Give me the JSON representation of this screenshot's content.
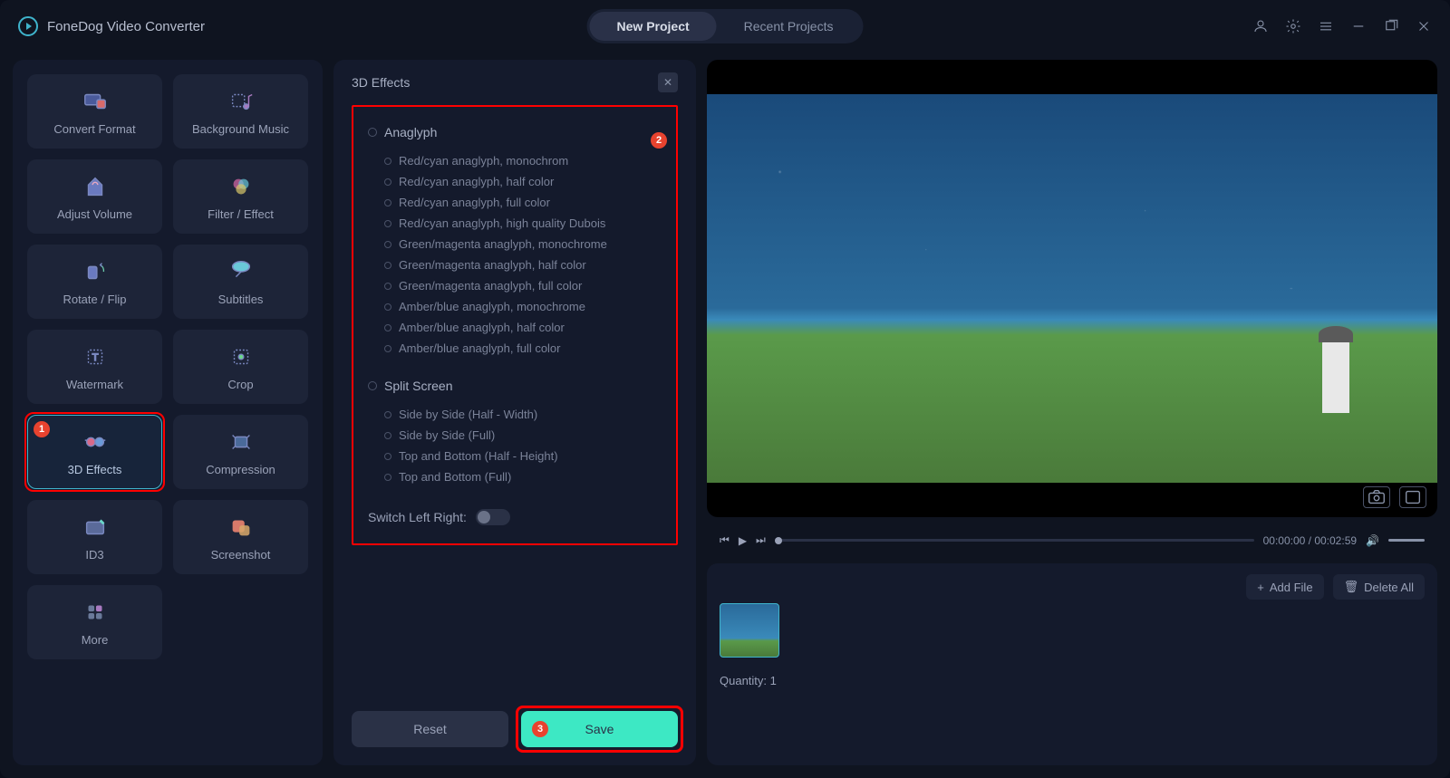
{
  "app": {
    "title": "FoneDog Video Converter"
  },
  "tabs": {
    "new": "New Project",
    "recent": "Recent Projects"
  },
  "tools": [
    {
      "key": "convert-format",
      "label": "Convert Format"
    },
    {
      "key": "background-music",
      "label": "Background Music"
    },
    {
      "key": "adjust-volume",
      "label": "Adjust Volume"
    },
    {
      "key": "filter-effect",
      "label": "Filter / Effect"
    },
    {
      "key": "rotate-flip",
      "label": "Rotate / Flip"
    },
    {
      "key": "subtitles",
      "label": "Subtitles"
    },
    {
      "key": "watermark",
      "label": "Watermark"
    },
    {
      "key": "crop",
      "label": "Crop"
    },
    {
      "key": "3d-effects",
      "label": "3D Effects"
    },
    {
      "key": "compression",
      "label": "Compression"
    },
    {
      "key": "id3",
      "label": "ID3"
    },
    {
      "key": "screenshot",
      "label": "Screenshot"
    },
    {
      "key": "more",
      "label": "More"
    }
  ],
  "panel": {
    "title": "3D Effects",
    "group1": "Anaglyph",
    "anaglyph": [
      "Red/cyan anaglyph, monochrom",
      "Red/cyan anaglyph, half color",
      "Red/cyan anaglyph, full color",
      "Red/cyan anaglyph, high quality Dubois",
      "Green/magenta anaglyph, monochrome",
      "Green/magenta anaglyph, half color",
      "Green/magenta anaglyph, full color",
      "Amber/blue anaglyph, monochrome",
      "Amber/blue anaglyph, half color",
      "Amber/blue anaglyph, full color"
    ],
    "group2": "Split Screen",
    "split": [
      "Side by Side (Half - Width)",
      "Side by Side (Full)",
      "Top and Bottom (Half - Height)",
      "Top and Bottom (Full)"
    ],
    "switch_label": "Switch Left Right:",
    "reset": "Reset",
    "save": "Save"
  },
  "player": {
    "current": "00:00:00",
    "duration": "00:02:59",
    "sep": " / "
  },
  "files": {
    "add": "Add File",
    "delete": "Delete All",
    "quantity_label": "Quantity: ",
    "quantity_value": "1"
  },
  "badges": {
    "n1": "1",
    "n2": "2",
    "n3": "3"
  }
}
